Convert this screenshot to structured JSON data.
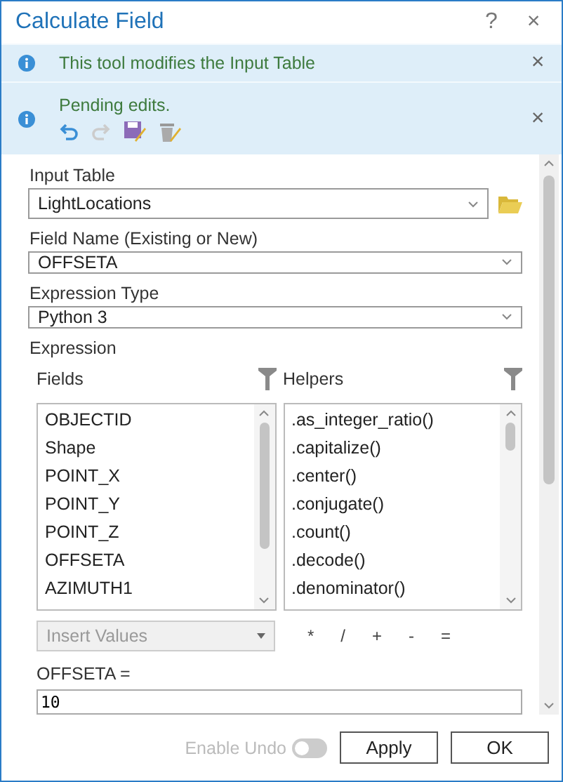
{
  "window": {
    "title": "Calculate Field",
    "help": "?",
    "close": "×"
  },
  "banners": [
    {
      "kind": "message",
      "text": "This tool modifies the Input Table",
      "close": "×"
    },
    {
      "kind": "edits",
      "text": "Pending edits.",
      "close": "×"
    }
  ],
  "form": {
    "input_table": {
      "label": "Input Table",
      "value": "LightLocations"
    },
    "field_name": {
      "label": "Field Name (Existing or New)",
      "value": "OFFSETA"
    },
    "expression_type": {
      "label": "Expression Type",
      "value": "Python 3"
    },
    "expression": {
      "label": "Expression",
      "fields": {
        "label": "Fields",
        "items": [
          "OBJECTID",
          "Shape",
          "POINT_X",
          "POINT_Y",
          "POINT_Z",
          "OFFSETA",
          "AZIMUTH1"
        ]
      },
      "helpers": {
        "label": "Helpers",
        "items": [
          ".as_integer_ratio()",
          ".capitalize()",
          ".center()",
          ".conjugate()",
          ".count()",
          ".decode()",
          ".denominator()"
        ]
      },
      "insert_values": {
        "placeholder": "Insert Values",
        "disabled": true
      },
      "operators": [
        "*",
        "/",
        "+",
        "-",
        "="
      ],
      "target": "OFFSETA =",
      "code": "10"
    }
  },
  "footer": {
    "undo": {
      "label": "Enable Undo",
      "on": false
    },
    "buttons": [
      "Apply",
      "OK"
    ]
  }
}
